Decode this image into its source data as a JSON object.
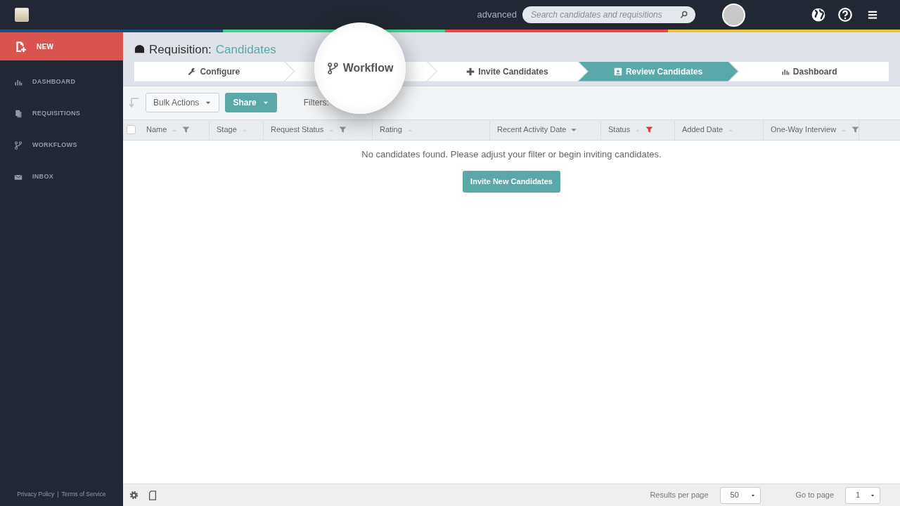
{
  "topbar": {
    "mode_label": "advanced",
    "search": {
      "placeholder": "Search candidates and requisitions"
    }
  },
  "sidebar": {
    "items": [
      {
        "label": "NEW",
        "kind": "action",
        "selected": true
      },
      {
        "label": "DASHBOARD",
        "kind": "chart",
        "selected": false
      },
      {
        "label": "REQUISITIONS",
        "kind": "docs",
        "selected": false
      },
      {
        "label": "WORKFLOWS",
        "kind": "branch",
        "selected": false
      },
      {
        "label": "INBOX",
        "kind": "mail",
        "selected": false
      }
    ],
    "footer_links": [
      "Privacy Policy",
      "Terms of Service"
    ],
    "footer_separator": "|"
  },
  "page": {
    "title_prefix": "Requisition:",
    "title_link": "Candidates"
  },
  "steps": [
    {
      "label": "Configure",
      "kind": "wrench",
      "selected": false,
      "magnified": false
    },
    {
      "label": "Workflow",
      "kind": "branch",
      "selected": false,
      "magnified": true
    },
    {
      "label": "Invite Candidates",
      "kind": "plus",
      "selected": false,
      "magnified": false
    },
    {
      "label": "Review Candidates",
      "kind": "person",
      "selected": true,
      "magnified": false
    },
    {
      "label": "Dashboard",
      "kind": "chart",
      "selected": false,
      "magnified": false
    }
  ],
  "toolbar": {
    "bulk_actions": "Bulk Actions",
    "share": "Share",
    "filters_label": "Filters:"
  },
  "table": {
    "select_all": {
      "checked": false
    },
    "columns": [
      {
        "label": "Name",
        "sorted": false,
        "filterable": true,
        "filter_active": false
      },
      {
        "label": "Stage",
        "sorted": false,
        "filterable": false
      },
      {
        "label": "Request Status",
        "sorted": false,
        "filterable": true,
        "filter_active": false
      },
      {
        "label": "Rating",
        "sorted": false,
        "filterable": false
      },
      {
        "label": "Recent Activity Date",
        "sorted": true,
        "filterable": false
      },
      {
        "label": "Status",
        "sorted": false,
        "filterable": true,
        "filter_active": true
      },
      {
        "label": "Added Date",
        "sorted": false,
        "filterable": false
      },
      {
        "label": "One-Way Interview",
        "sorted": false,
        "filterable": true,
        "filter_active": false
      }
    ],
    "empty_message": "No candidates found. Please adjust your filter or begin inviting candidates.",
    "empty_button": "Invite New Candidates"
  },
  "footer": {
    "results_label": "Results per page",
    "results_value": "50",
    "page_label": "Go to page",
    "page_value": "1"
  }
}
